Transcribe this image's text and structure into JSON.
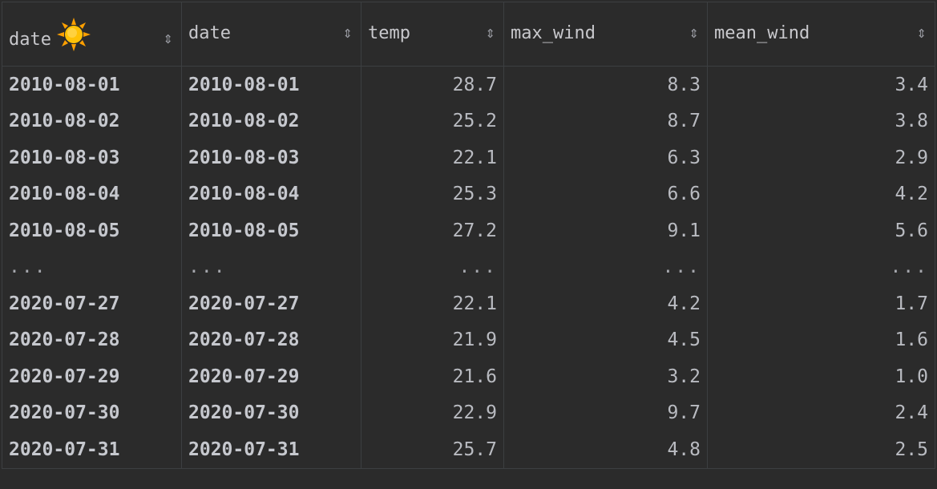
{
  "table": {
    "columns": [
      {
        "label": "date",
        "has_sun_icon": true,
        "align": "left"
      },
      {
        "label": "date",
        "has_sun_icon": false,
        "align": "left"
      },
      {
        "label": "temp",
        "has_sun_icon": false,
        "align": "right"
      },
      {
        "label": "max_wind",
        "has_sun_icon": false,
        "align": "right"
      },
      {
        "label": "mean_wind",
        "has_sun_icon": false,
        "align": "right"
      }
    ],
    "sort_glyph": "⇕",
    "rows": [
      [
        "2010-08-01",
        "2010-08-01",
        "28.7",
        "8.3",
        "3.4"
      ],
      [
        "2010-08-02",
        "2010-08-02",
        "25.2",
        "8.7",
        "3.8"
      ],
      [
        "2010-08-03",
        "2010-08-03",
        "22.1",
        "6.3",
        "2.9"
      ],
      [
        "2010-08-04",
        "2010-08-04",
        "25.3",
        "6.6",
        "4.2"
      ],
      [
        "2010-08-05",
        "2010-08-05",
        "27.2",
        "9.1",
        "5.6"
      ],
      [
        "...",
        "...",
        "...",
        "...",
        "..."
      ],
      [
        "2020-07-27",
        "2020-07-27",
        "22.1",
        "4.2",
        "1.7"
      ],
      [
        "2020-07-28",
        "2020-07-28",
        "21.9",
        "4.5",
        "1.6"
      ],
      [
        "2020-07-29",
        "2020-07-29",
        "21.6",
        "3.2",
        "1.0"
      ],
      [
        "2020-07-30",
        "2020-07-30",
        "22.9",
        "9.7",
        "2.4"
      ],
      [
        "2020-07-31",
        "2020-07-31",
        "25.7",
        "4.8",
        "2.5"
      ]
    ]
  },
  "colors": {
    "background": "#2b2b2b",
    "grid_line": "#3c3f41",
    "text": "#bcbec4",
    "sun_core": "#ffb300",
    "sun_rays": "#ffa000"
  },
  "icons": {
    "header_icon": "sun-emoji-icon",
    "sort_icon": "sort-arrows-icon"
  }
}
